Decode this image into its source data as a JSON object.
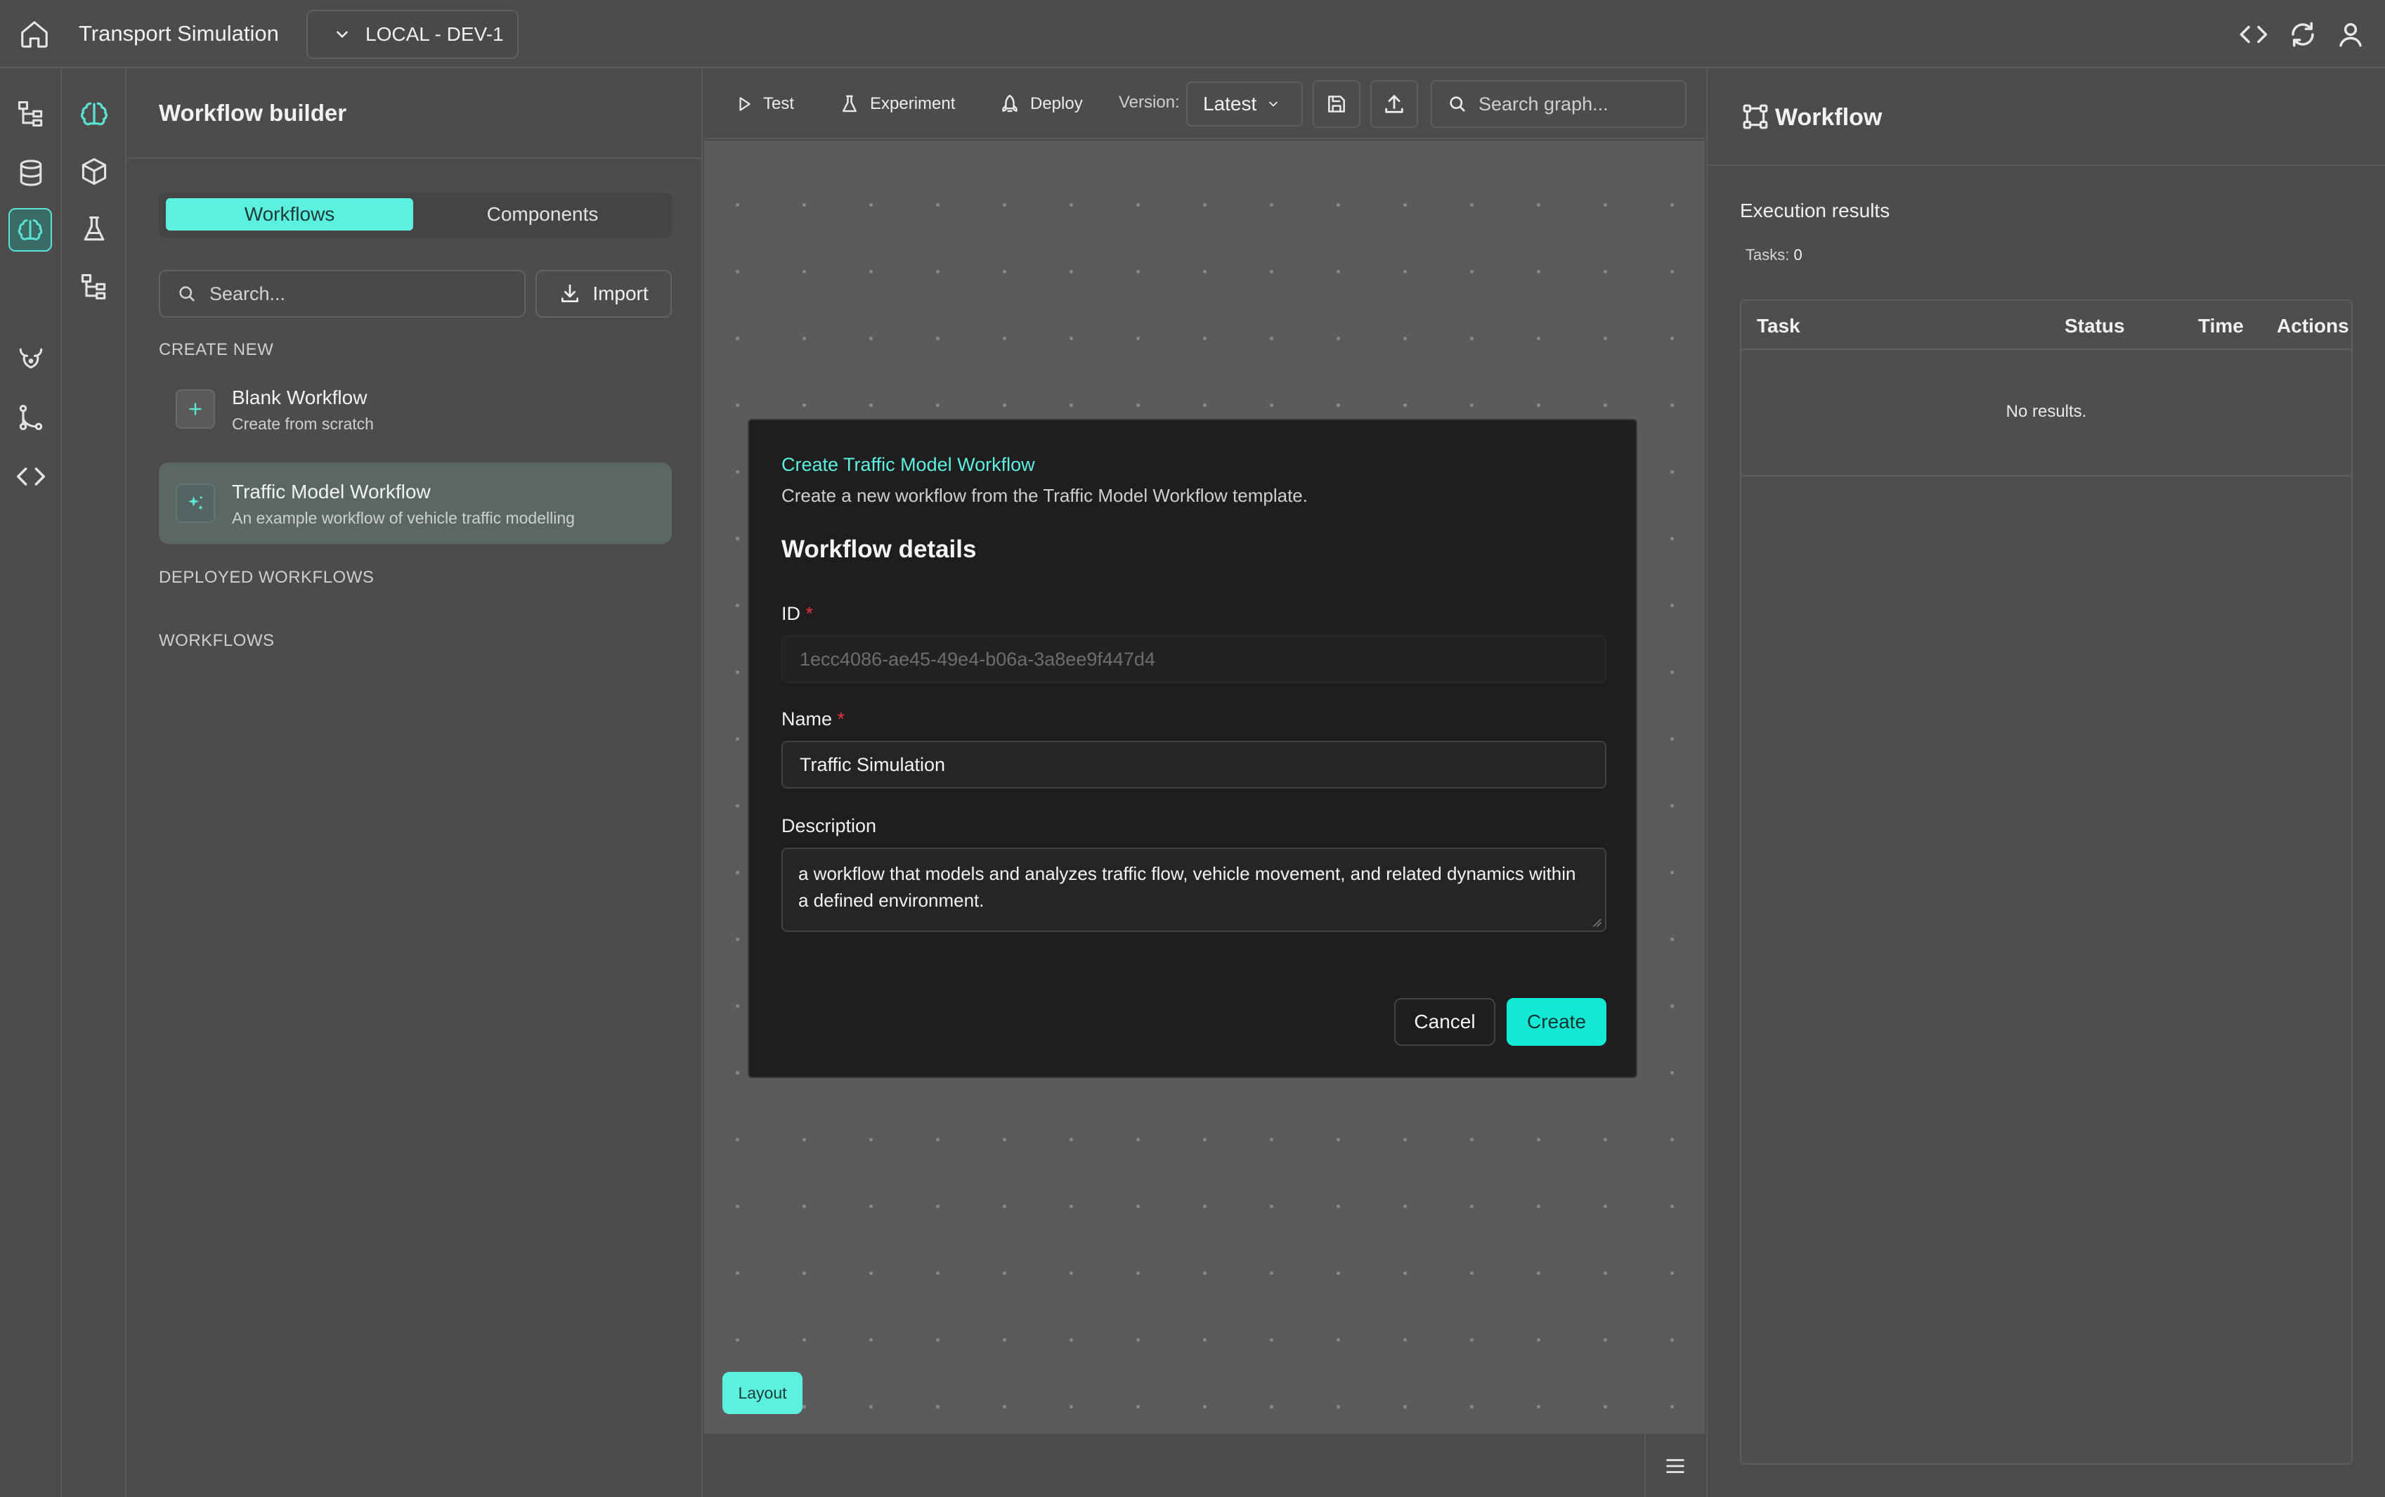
{
  "topbar": {
    "title": "Transport Simulation",
    "environment": "LOCAL - DEV-1"
  },
  "icons": {
    "home": "home-icon",
    "code": "code-icon",
    "refresh": "refresh-icon",
    "user": "user-icon"
  },
  "left_panel": {
    "title": "Workflow builder",
    "tabs": [
      {
        "label": "Workflows",
        "active": true
      },
      {
        "label": "Components",
        "active": false
      }
    ],
    "search_placeholder": "Search...",
    "import_label": "Import",
    "create_new_label": "CREATE NEW",
    "templates": [
      {
        "title": "Blank Workflow",
        "subtitle": "Create from scratch",
        "icon": "plus-icon"
      },
      {
        "title": "Traffic Model Workflow",
        "subtitle": "An example workflow of vehicle traffic modelling",
        "icon": "sparkle-icon",
        "selected": true
      }
    ],
    "deployed_label": "DEPLOYED WORKFLOWS",
    "workflows_label": "WORKFLOWS"
  },
  "toolbar": {
    "test": "Test",
    "experiment": "Experiment",
    "deploy": "Deploy",
    "version_label": "Version:",
    "version_value": "Latest",
    "search_placeholder": "Search graph..."
  },
  "canvas": {
    "layout_button": "Layout"
  },
  "dialog": {
    "kicker": "Create Traffic Model Workflow",
    "description": "Create a new workflow from the Traffic Model Workflow template.",
    "heading": "Workflow details",
    "id_label": "ID",
    "id_value": "1ecc4086-ae45-49e4-b06a-3a8ee9f447d4",
    "name_label": "Name",
    "name_value": "Traffic Simulation",
    "description_label": "Description",
    "description_value": "a workflow that models and analyzes traffic flow, vehicle movement, and related dynamics within a defined environment.",
    "required_mark": "*",
    "cancel": "Cancel",
    "create": "Create"
  },
  "right_panel": {
    "title": "Workflow",
    "execution_title": "Execution results",
    "tasks_label": "Tasks:",
    "tasks_count": "0",
    "columns": [
      "Task",
      "Status",
      "Time",
      "Actions"
    ],
    "empty_text": "No results."
  },
  "colors": {
    "accent": "#5cf0df",
    "create_button": "#12ead6",
    "required": "#e0343f",
    "background": "#4d4b4c",
    "dialog": "#1f1d1e"
  }
}
